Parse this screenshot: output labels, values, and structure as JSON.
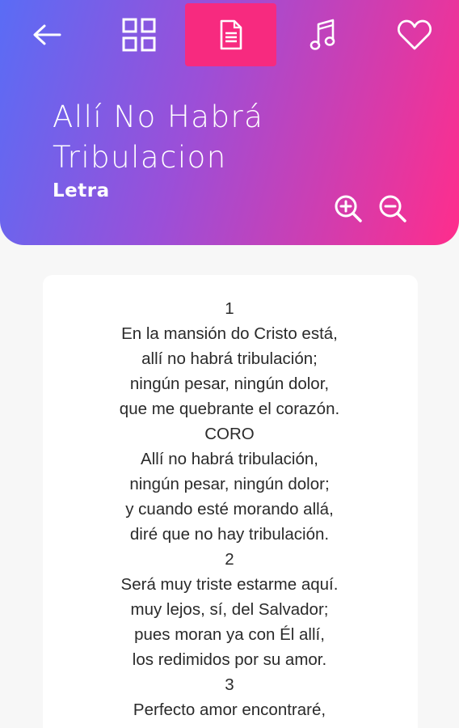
{
  "header": {
    "title": "Allí No Habrá Tribulacion",
    "subtitle": "Letra"
  },
  "toolbar": {
    "buttons": [
      {
        "icon": "back-arrow-icon",
        "active": false
      },
      {
        "icon": "grid-icon",
        "active": false
      },
      {
        "icon": "document-icon",
        "active": true
      },
      {
        "icon": "music-note-icon",
        "active": false
      },
      {
        "icon": "heart-icon",
        "active": false
      }
    ]
  },
  "zoom": {
    "in_icon": "zoom-in-icon",
    "out_icon": "zoom-out-icon"
  },
  "lyrics": [
    "1",
    "En la mansión do Cristo está,",
    "allí no habrá tribulación;",
    "ningún pesar, ningún dolor,",
    "que me quebrante el corazón.",
    "CORO",
    "Allí no habrá tribulación,",
    "ningún pesar, ningún dolor;",
    "y cuando esté morando allá,",
    "diré que no hay tribulación.",
    "2",
    "Será muy triste estarme aquí.",
    "muy lejos, sí, del Salvador;",
    "pues moran ya con Él allí,",
    "los redimidos por su amor.",
    "3",
    "Perfecto amor encontraré,"
  ],
  "colors": {
    "gradient_start": "#5a6cf5",
    "gradient_mid": "#9b4fd8",
    "gradient_end": "#ff2d8c",
    "active_tab": "#f72a7f",
    "background": "#f7f7f7",
    "card": "#ffffff",
    "text": "#2a2a2a"
  }
}
